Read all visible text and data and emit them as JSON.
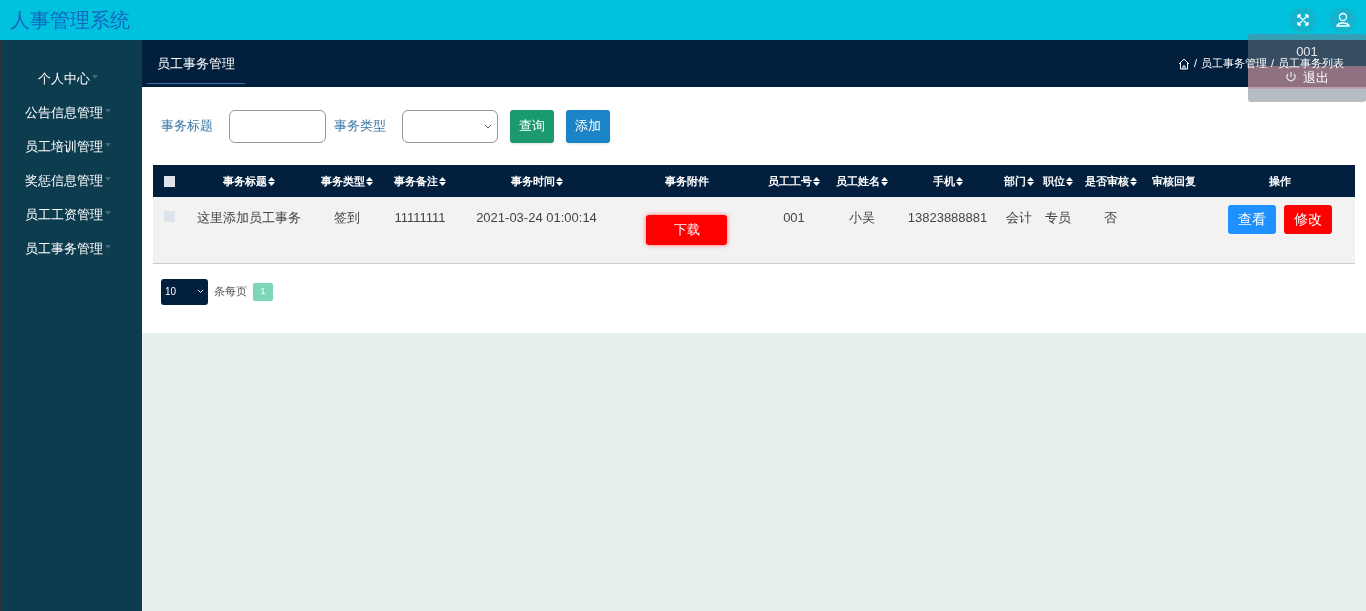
{
  "header": {
    "title": "人事管理系统"
  },
  "user_menu": {
    "items": [
      {
        "kind": "label",
        "label": "001"
      },
      {
        "kind": "logout",
        "label": "退出"
      }
    ]
  },
  "sidebar": {
    "items": [
      {
        "kind": "link",
        "label": "个人中心"
      },
      {
        "kind": "menu",
        "label": "公告信息管理"
      },
      {
        "kind": "menu",
        "label": "员工培训管理"
      },
      {
        "kind": "menu",
        "label": "奖惩信息管理"
      },
      {
        "kind": "menu",
        "label": "员工工资管理"
      },
      {
        "kind": "menu",
        "label": "员工事务管理"
      }
    ]
  },
  "page_tab": "员工事务管理",
  "breadcrumb": {
    "items": [
      {
        "separator": "/",
        "label": "员工事务管理"
      },
      {
        "separator": "/",
        "label": "员工事务列表"
      }
    ]
  },
  "search": {
    "fields": [
      {
        "kind": "text",
        "label": "事务标题"
      },
      {
        "kind": "select",
        "label": "事务类型"
      }
    ],
    "buttons": [
      {
        "kind": "query",
        "label": "查询"
      },
      {
        "kind": "add",
        "label": "添加"
      }
    ]
  },
  "table": {
    "select_all": {
      "checked": false
    },
    "columns": [
      {
        "label": "事务标题",
        "sortable": true
      },
      {
        "label": "事务类型",
        "sortable": true
      },
      {
        "label": "事务备注",
        "sortable": true
      },
      {
        "label": "事务时间",
        "sortable": true
      },
      {
        "label": "事务附件",
        "sortable": false
      },
      {
        "label": "员工工号",
        "sortable": true
      },
      {
        "label": "员工姓名",
        "sortable": true
      },
      {
        "label": "手机",
        "sortable": true
      },
      {
        "label": "部门",
        "sortable": true
      },
      {
        "label": "职位",
        "sortable": true
      },
      {
        "label": "是否审核",
        "sortable": true
      },
      {
        "label": "审核回复",
        "sortable": false
      },
      {
        "label": "操作",
        "sortable": false
      }
    ],
    "rows": [
      {
        "checked": false,
        "cells": [
          "这里添加员工事务",
          "签到",
          "11111111",
          "2021-03-24 01:00:14",
          {
            "kind": "button",
            "label": "下载"
          },
          "001",
          "小吴",
          "13823888881",
          "会计",
          "专员",
          "否",
          ""
        ],
        "actions": [
          {
            "kind": "view",
            "label": "查看"
          },
          {
            "kind": "edit",
            "label": "修改"
          }
        ]
      }
    ]
  },
  "pagination": {
    "page_size": "10",
    "per_page_label": "条每页",
    "pages": [
      {
        "label": "1",
        "selected": true
      }
    ]
  }
}
